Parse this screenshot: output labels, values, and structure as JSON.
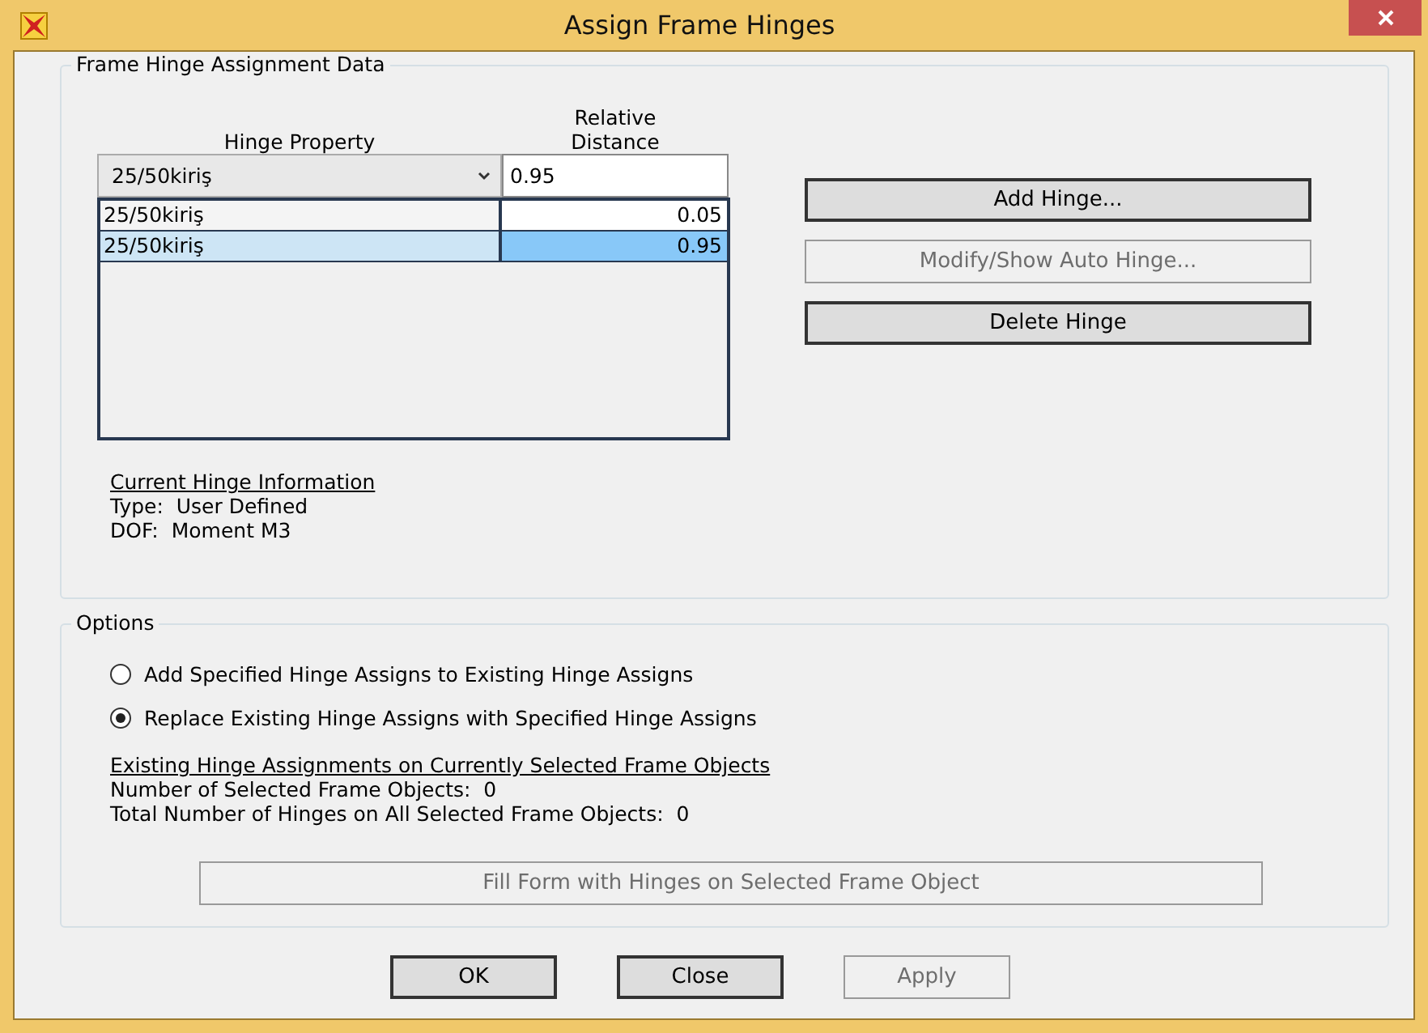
{
  "window": {
    "title": "Assign Frame Hinges"
  },
  "hinge_data": {
    "legend": "Frame Hinge Assignment Data",
    "columns": [
      "Hinge Property",
      "Relative Distance"
    ],
    "property_select": {
      "value": "25/50kiriş"
    },
    "distance_field": {
      "value": "0.95"
    },
    "rows": [
      {
        "property": "25/50kiriş",
        "distance": "0.05",
        "selected": false
      },
      {
        "property": "25/50kiriş",
        "distance": "0.95",
        "selected": true
      }
    ],
    "buttons": [
      {
        "label": "Add Hinge...",
        "disabled": false
      },
      {
        "label": "Modify/Show Auto Hinge...",
        "disabled": true
      },
      {
        "label": "Delete Hinge",
        "disabled": false
      }
    ],
    "info": {
      "heading": "Current Hinge Information",
      "lines": [
        "Type:  User Defined",
        "DOF:  Moment M3"
      ]
    }
  },
  "options": {
    "legend": "Options",
    "radios": [
      {
        "label": "Add Specified Hinge Assigns to Existing Hinge Assigns",
        "selected": false
      },
      {
        "label": "Replace Existing Hinge Assigns with Specified Hinge Assigns",
        "selected": true
      }
    ],
    "assignments": {
      "heading": "Existing Hinge Assignments on Currently Selected Frame Objects",
      "lines": [
        "Number of Selected Frame Objects:  0",
        "Total Number of Hinges on All Selected Frame Objects:  0"
      ]
    },
    "fill_button": {
      "label": "Fill Form with Hinges on Selected Frame Object",
      "disabled": true
    }
  },
  "buttons": [
    {
      "label": "OK",
      "disabled": false
    },
    {
      "label": "Close",
      "disabled": false
    },
    {
      "label": "Apply",
      "disabled": true
    }
  ]
}
